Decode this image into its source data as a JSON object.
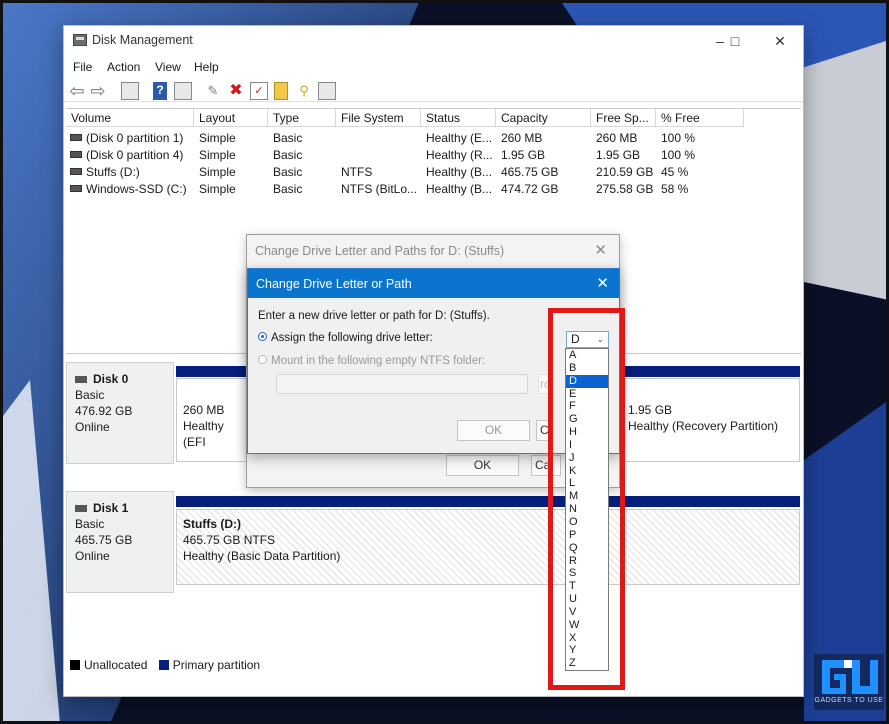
{
  "window": {
    "title": "Disk Management"
  },
  "menu": [
    "File",
    "Action",
    "View",
    "Help"
  ],
  "columns": [
    "Volume",
    "Layout",
    "Type",
    "File System",
    "Status",
    "Capacity",
    "Free Sp...",
    "% Free"
  ],
  "volumes": [
    {
      "volume": "(Disk 0 partition 1)",
      "layout": "Simple",
      "type": "Basic",
      "fs": "",
      "status": "Healthy (E...",
      "capacity": "260 MB",
      "free": "260 MB",
      "pct": "100 %"
    },
    {
      "volume": "(Disk 0 partition 4)",
      "layout": "Simple",
      "type": "Basic",
      "fs": "",
      "status": "Healthy (R...",
      "capacity": "1.95 GB",
      "free": "1.95 GB",
      "pct": "100 %"
    },
    {
      "volume": "Stuffs (D:)",
      "layout": "Simple",
      "type": "Basic",
      "fs": "NTFS",
      "status": "Healthy (B...",
      "capacity": "465.75 GB",
      "free": "210.59 GB",
      "pct": "45 %"
    },
    {
      "volume": "Windows-SSD (C:)",
      "layout": "Simple",
      "type": "Basic",
      "fs": "NTFS (BitLo...",
      "status": "Healthy (B...",
      "capacity": "474.72 GB",
      "free": "275.58 GB",
      "pct": "58 %"
    }
  ],
  "disks": {
    "disk0": {
      "name": "Disk 0",
      "type": "Basic",
      "size": "476.92 GB",
      "state": "Online",
      "efi": {
        "size": "260 MB",
        "status": "Healthy (EFI"
      },
      "recovery": {
        "size": "1.95 GB",
        "status": "Healthy (Recovery Partition)"
      }
    },
    "disk1": {
      "name": "Disk 1",
      "type": "Basic",
      "size": "465.75 GB",
      "state": "Online",
      "part": {
        "name": "Stuffs  (D:)",
        "size": "465.75 GB NTFS",
        "status": "Healthy (Basic Data Partition)"
      }
    }
  },
  "legend": {
    "unallocated": "Unallocated",
    "primary": "Primary partition",
    "unallocated_color": "#000000",
    "primary_color": "#061e7c"
  },
  "back_dialog": {
    "title": "Change Drive Letter and Paths for D: (Stuffs)",
    "ok": "OK",
    "cancel_fragment": "Ca"
  },
  "front_dialog": {
    "title": "Change Drive Letter or Path",
    "prompt": "Enter a new drive letter or path for D: (Stuffs).",
    "assign_label": "Assign the following drive letter:",
    "mount_label": "Mount in the following empty NTFS folder:",
    "browse_fragment": "ro",
    "ok": "OK",
    "cancel_fragment": "C",
    "selected_letter": "D"
  },
  "letters": [
    "A",
    "B",
    "D",
    "E",
    "F",
    "G",
    "H",
    "I",
    "J",
    "K",
    "L",
    "M",
    "N",
    "O",
    "P",
    "Q",
    "R",
    "S",
    "T",
    "U",
    "V",
    "W",
    "X",
    "Y",
    "Z"
  ],
  "selected_letter": "D",
  "watermark": {
    "text": "GADGETS TO USE"
  }
}
